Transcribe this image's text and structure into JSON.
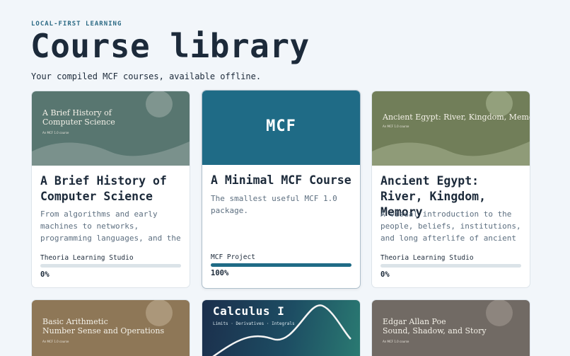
{
  "header": {
    "eyebrow": "LOCAL-FIRST LEARNING",
    "title": "Course library",
    "subtitle": "Your compiled MCF courses, available offline."
  },
  "courses": [
    {
      "cover_title_line1": "A Brief History of",
      "cover_title_line2": "Computer Science",
      "cover_note": "An MCF 1.0 course",
      "title": "A Brief History of Computer Science",
      "description": "From algorithms and early machines to networks, programming languages, and the",
      "author": "Theoria Learning Studio",
      "progress": 0,
      "progress_label": "0%",
      "cover_color": "#587670"
    },
    {
      "cover_logo": "MCF",
      "title": "A Minimal MCF Course",
      "description": "The smallest useful MCF 1.0 package.",
      "author": "MCF Project",
      "progress": 100,
      "progress_label": "100%",
      "cover_color": "#1f6b86"
    },
    {
      "cover_title_line1": "Ancient Egypt: River, Kingdom, Memory",
      "cover_note": "An MCF 1.0 course",
      "title": "Ancient Egypt: River, Kingdom, Memory",
      "description": "A visual introduction to the people, beliefs, institutions, and long afterlife of ancient",
      "author": "Theoria Learning Studio",
      "progress": 0,
      "progress_label": "0%",
      "cover_color": "#717e59"
    },
    {
      "cover_title_line1": "Basic Arithmetic",
      "cover_title_line2": "Number Sense and Operations",
      "cover_note": "An MCF 1.0 course",
      "cover_color": "#8e7757"
    },
    {
      "cover_title_line1": "Calculus I",
      "cover_subtitle": "Limits · Derivatives · Integrals",
      "cover_color": "#1e3a55"
    },
    {
      "cover_title_line1": "Edgar Allan Poe",
      "cover_title_line2": "Sound, Shadow, and Story",
      "cover_note": "An MCF 1.0 course",
      "cover_color": "#716a64"
    }
  ]
}
